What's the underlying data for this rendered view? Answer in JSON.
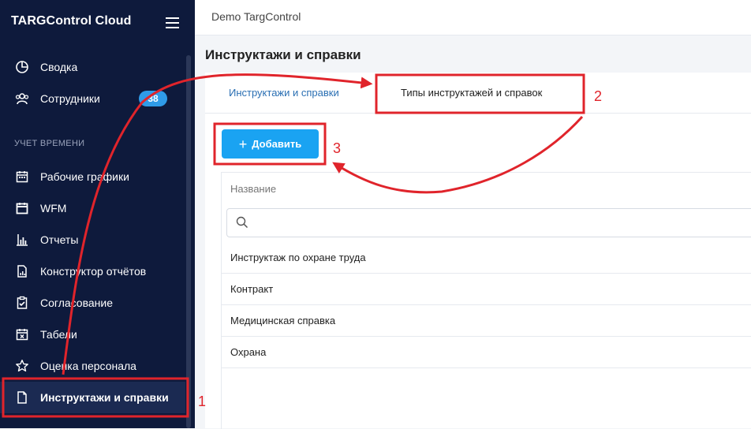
{
  "app": {
    "brand": "TARGControl Cloud",
    "org": "Demo TargControl"
  },
  "sidebar": {
    "items": [
      {
        "label": "Сводка",
        "icon": "pie-chart-icon"
      },
      {
        "label": "Сотрудники",
        "icon": "users-icon",
        "badge": "38"
      },
      {
        "label": "Рабочие графики",
        "icon": "calendar-icon"
      },
      {
        "label": "WFM",
        "icon": "calendar-grid-icon"
      },
      {
        "label": "Отчеты",
        "icon": "bar-chart-icon"
      },
      {
        "label": "Конструктор отчётов",
        "icon": "document-chart-icon"
      },
      {
        "label": "Согласование",
        "icon": "clipboard-check-icon"
      },
      {
        "label": "Табели",
        "icon": "calendar-x-icon"
      },
      {
        "label": "Оценка персонала",
        "icon": "star-icon"
      },
      {
        "label": "Инструктажи и справки",
        "icon": "file-icon"
      }
    ],
    "section_label": "УЧЕТ ВРЕМЕНИ"
  },
  "page": {
    "title": "Инструктажи и справки",
    "tabs": [
      {
        "label": "Инструктажи и справки"
      },
      {
        "label": "Типы инструктажей и справок"
      }
    ],
    "add_label": "Добавить",
    "column_header": "Название",
    "rows": [
      "Инструктаж по охране труда",
      "Контракт",
      "Медицинская справка",
      "Охрана"
    ]
  },
  "annotations": {
    "step1": "1",
    "step2": "2",
    "step3": "3",
    "color": "#e0242b"
  },
  "colors": {
    "sidebar_bg": "#0e1a3c",
    "accent": "#1aa3f2",
    "badge": "#2f9be8"
  }
}
